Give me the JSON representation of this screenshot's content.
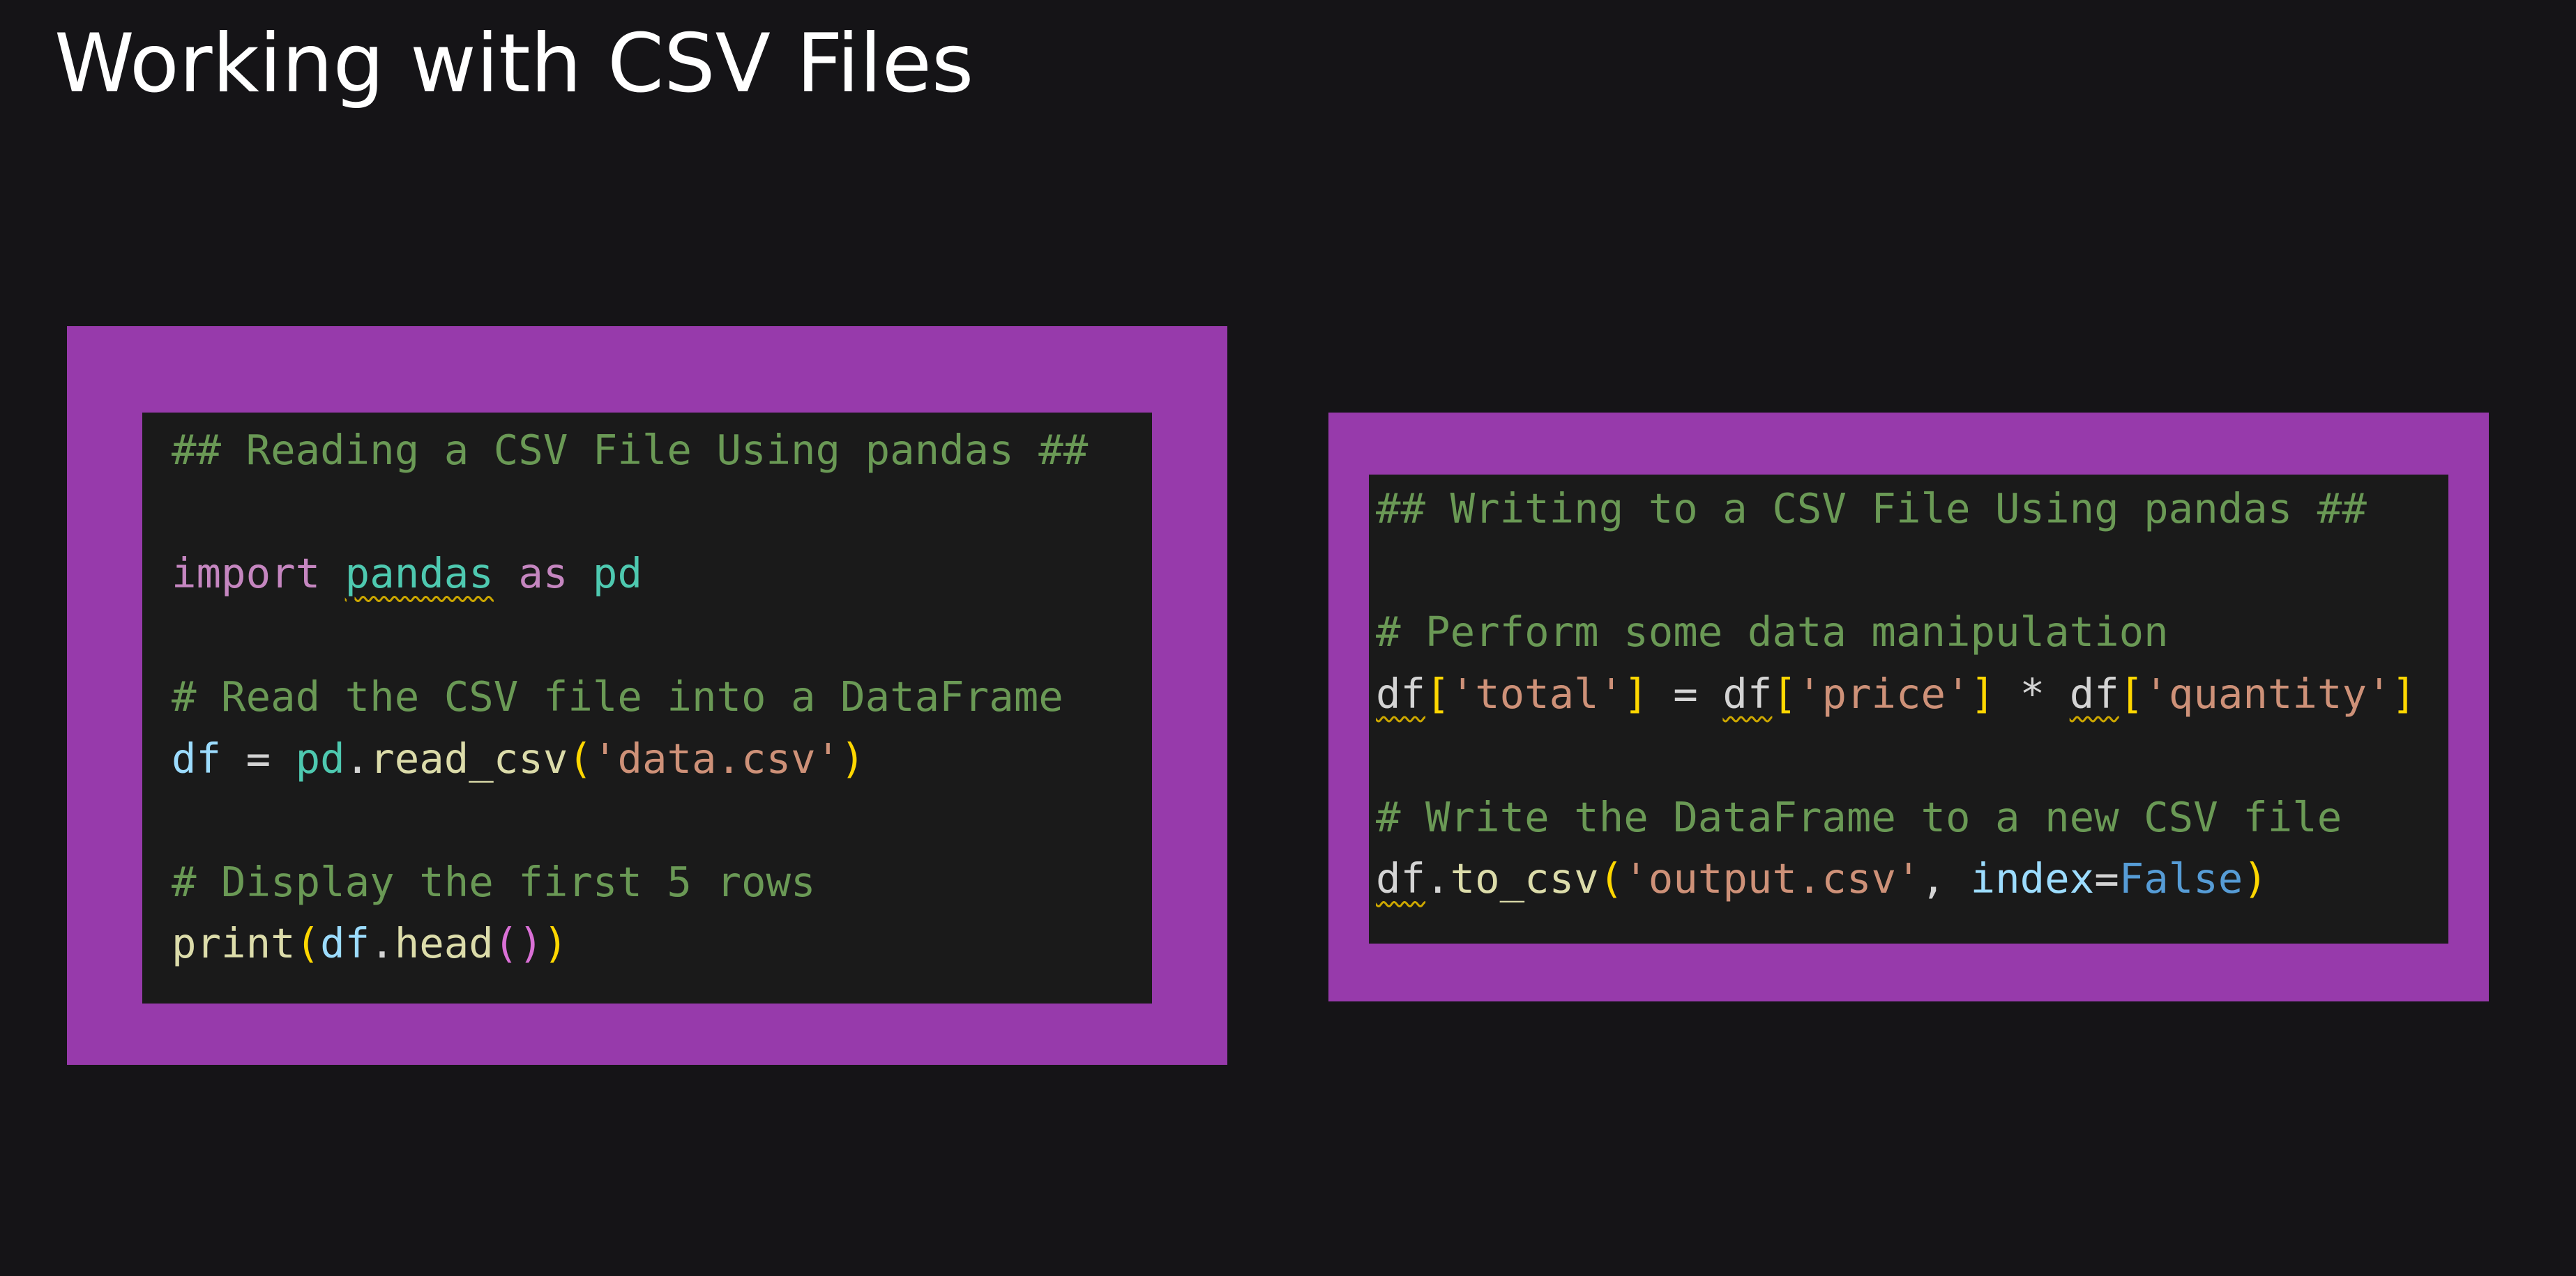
{
  "slide": {
    "title": "Working with CSV Files"
  },
  "colors": {
    "background": "#151417",
    "frame": "#973aab",
    "code_background": "#1a1a1a",
    "comment": "#6a9955",
    "keyword": "#c586c0",
    "module": "#4ec9b0",
    "variable": "#9cdcfe",
    "function": "#dcdcaa",
    "string": "#ce9178",
    "bracket": "#ffd700",
    "bracket_nested": "#da70d6",
    "constant": "#569cd6",
    "warning_squiggle": "#cca700"
  },
  "left_code": {
    "line1": "## Reading a CSV File Using pandas ##",
    "line3": {
      "kw_import": "import",
      "module": "pandas",
      "kw_as": "as",
      "alias": "pd"
    },
    "line5": "# Read the CSV file into a DataFrame",
    "line6": {
      "var": "df",
      "op": "=",
      "module": "pd",
      "dot": ".",
      "func": "read_csv",
      "open": "(",
      "arg": "'data.csv'",
      "close": ")"
    },
    "line8": "# Display the first 5 rows",
    "line9": {
      "func": "print",
      "open": "(",
      "var": "df",
      "dot": ".",
      "method": "head",
      "inner_open": "(",
      "inner_close": ")",
      "close": ")"
    }
  },
  "right_code": {
    "line1": "## Writing to a CSV File Using pandas ##",
    "line3": "# Perform some data manipulation",
    "line4": {
      "df1": "df",
      "b1o": "[",
      "s1": "'total'",
      "b1c": "]",
      "eq": "=",
      "df2": "df",
      "b2o": "[",
      "s2": "'price'",
      "b2c": "]",
      "mul": "*",
      "df3": "df",
      "b3o": "[",
      "s3": "'quantity'",
      "b3c": "]"
    },
    "line6": "# Write the DataFrame to a new CSV file",
    "line7": {
      "var": "df",
      "dot": ".",
      "method": "to_csv",
      "open": "(",
      "arg": "'output.csv'",
      "comma": ",",
      "param": "index",
      "eq": "=",
      "value": "False",
      "close": ")"
    }
  }
}
